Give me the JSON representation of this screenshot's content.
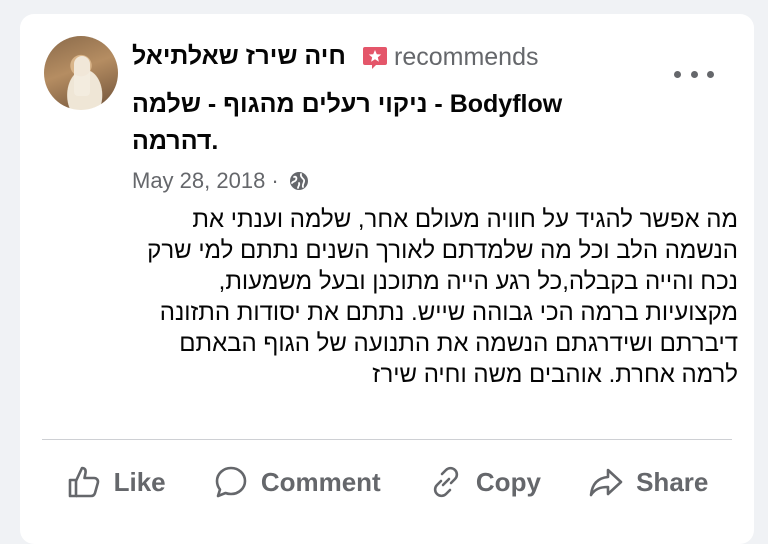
{
  "post": {
    "author": "חיה שירז שאלתיאל",
    "recommends_text": "recommends",
    "page_line1": "ניקוי רעלים מהגוף - שלמה - Bodyflow",
    "page_line2": "דהרמה.",
    "date": "May 28, 2018",
    "separator": "·",
    "body_lines": [
      "מה אפשר להגיד על חוויה מעולם אחר, שלמה וענתי את",
      "הנשמה הלב וכל מה שלמדתם לאורך השנים נתתם למי שרק",
      "נכח והייה בקבלה,כל רגע הייה מתוכנן ובעל משמעות,",
      "מקצועיות ברמה הכי גבוהה שייש. נתתם את יסודות התזונה",
      "דיברתם ושידרגתם הנשמה את התנועה של הגוף הבאתם",
      "לרמה אחרת. אוהבים משה וחיה שירז"
    ]
  },
  "actions": {
    "like": "Like",
    "comment": "Comment",
    "copy": "Copy",
    "share": "Share"
  },
  "icons": {
    "recommend": "recommend-star-icon",
    "globe": "globe-icon",
    "more": "more-options-icon"
  },
  "colors": {
    "recommend_badge": "#e4566a",
    "secondary_text": "#65676b"
  }
}
